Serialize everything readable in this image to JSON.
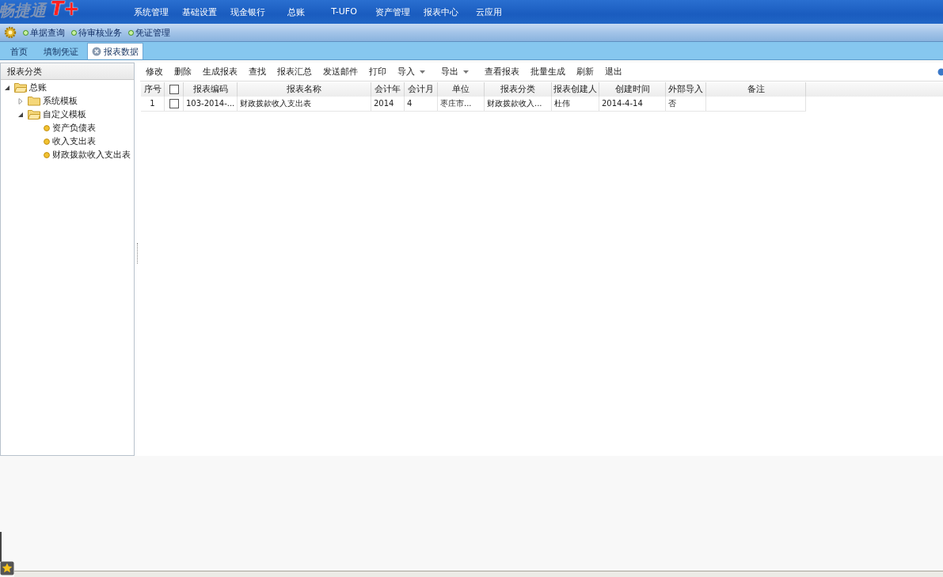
{
  "logo": {
    "text": "畅捷通",
    "mark": "T+"
  },
  "top_nav": [
    "系统管理",
    "基础设置",
    "现金银行",
    "总账",
    "T-UFO",
    "资产管理",
    "报表中心",
    "云应用"
  ],
  "quick_links": [
    "单据查询",
    "待审核业务",
    "凭证管理"
  ],
  "tabs": [
    {
      "label": "首页",
      "selected": false,
      "closable": false
    },
    {
      "label": "填制凭证",
      "selected": false,
      "closable": false
    },
    {
      "label": "报表数据",
      "selected": true,
      "closable": true
    }
  ],
  "sidebar": {
    "title": "报表分类",
    "tree": [
      {
        "label": "总账",
        "kind": "folder",
        "expanded": true,
        "children": [
          {
            "label": "系统模板",
            "kind": "folder",
            "expanded": false
          },
          {
            "label": "自定义模板",
            "kind": "folder",
            "expanded": true,
            "children": [
              {
                "label": "资产负债表",
                "kind": "leaf"
              },
              {
                "label": "收入支出表",
                "kind": "leaf"
              },
              {
                "label": "财政拨款收入支出表",
                "kind": "leaf"
              }
            ]
          }
        ]
      }
    ]
  },
  "toolbar": [
    {
      "label": "修改",
      "kind": "button"
    },
    {
      "label": "删除",
      "kind": "button"
    },
    {
      "label": "生成报表",
      "kind": "button"
    },
    {
      "label": "查找",
      "kind": "button"
    },
    {
      "label": "报表汇总",
      "kind": "button"
    },
    {
      "label": "发送邮件",
      "kind": "button"
    },
    {
      "label": "打印",
      "kind": "button"
    },
    {
      "label": "导入",
      "kind": "dropdown"
    },
    {
      "label": "导出",
      "kind": "dropdown"
    },
    {
      "label": "查看报表",
      "kind": "button"
    },
    {
      "label": "批量生成",
      "kind": "button"
    },
    {
      "label": "刷新",
      "kind": "button"
    },
    {
      "label": "退出",
      "kind": "button"
    }
  ],
  "table": {
    "columns": [
      "序号",
      "报表编码",
      "报表名称",
      "会计年",
      "会计月",
      "单位",
      "报表分类",
      "报表创建人",
      "创建时间",
      "外部导入",
      "备注"
    ],
    "header_checked": false,
    "rows": [
      {
        "checked": false,
        "cells": [
          "1",
          "103-2014-...",
          "财政拨款收入支出表",
          "2014",
          "4",
          "枣庄市...",
          "财政拨款收入...",
          "杜伟",
          "2014-4-14",
          "否",
          ""
        ]
      }
    ]
  }
}
